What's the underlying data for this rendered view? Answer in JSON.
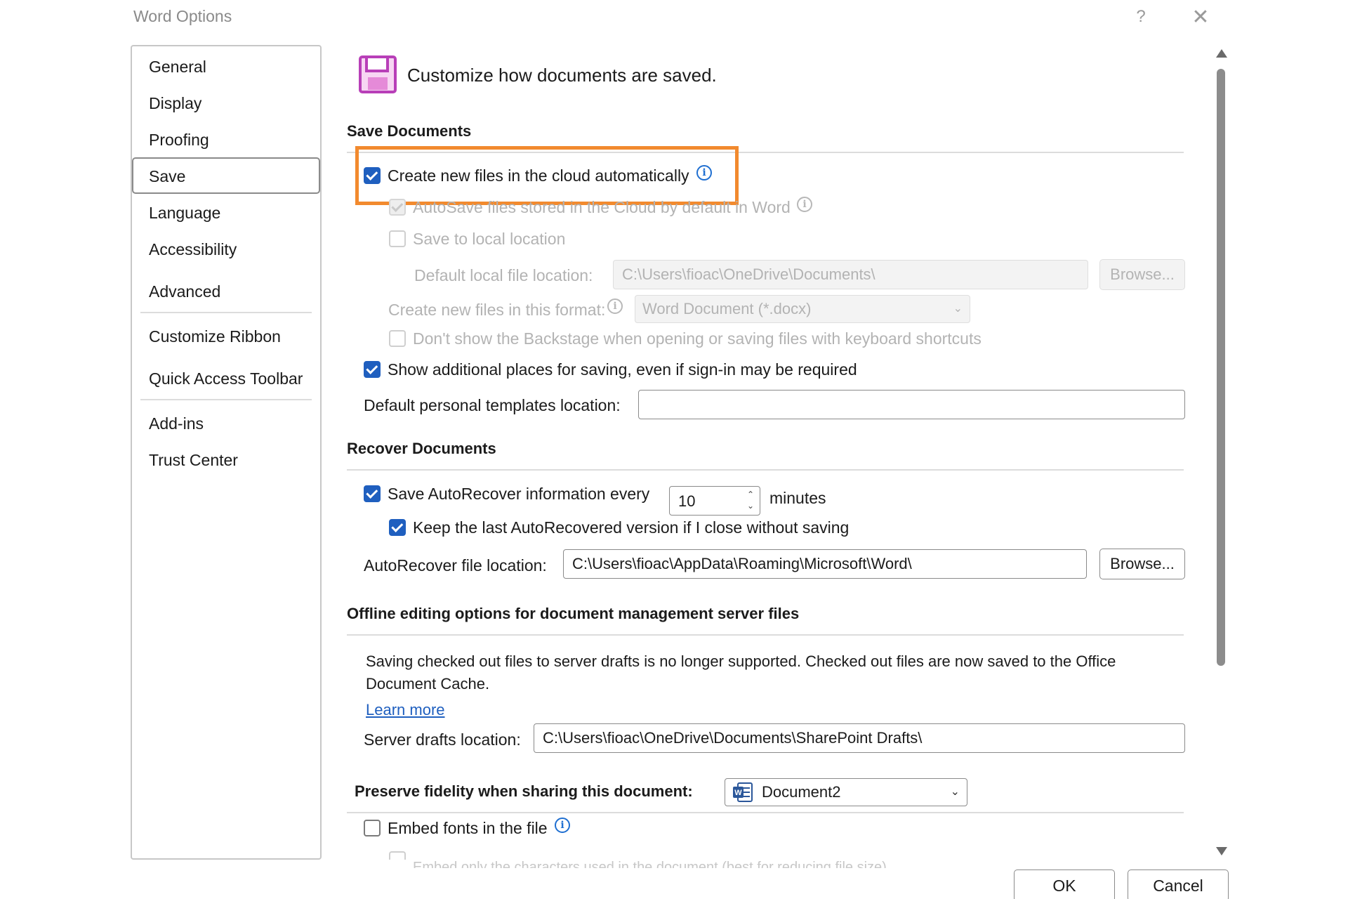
{
  "window": {
    "title": "Word Options",
    "help_label": "?",
    "close_label": "✕"
  },
  "sidebar": {
    "items": [
      {
        "label": "General"
      },
      {
        "label": "Display"
      },
      {
        "label": "Proofing"
      },
      {
        "label": "Save"
      },
      {
        "label": "Language"
      },
      {
        "label": "Accessibility"
      },
      {
        "label": "Advanced"
      },
      {
        "label": "Customize Ribbon"
      },
      {
        "label": "Quick Access Toolbar"
      },
      {
        "label": "Add-ins"
      },
      {
        "label": "Trust Center"
      }
    ],
    "selected": "Save"
  },
  "header": {
    "intro": "Customize how documents are saved."
  },
  "save_documents": {
    "heading": "Save Documents",
    "create_cloud": {
      "label": "Create new files in the cloud automatically",
      "checked": true
    },
    "autosave": {
      "label": "AutoSave files stored in the Cloud by default in Word",
      "checked": true,
      "enabled": false
    },
    "save_local": {
      "label": "Save to local location",
      "checked": false,
      "enabled": false
    },
    "default_local_label": "Default local file location:",
    "default_local_value": "C:\\Users\\fioac\\OneDrive\\Documents\\",
    "browse_label": "Browse...",
    "format_label": "Create new files in this format:",
    "format_value": "Word Document (*.docx)",
    "backstage": {
      "label": "Don't show the Backstage when opening or saving files with keyboard shortcuts",
      "checked": false,
      "enabled": false
    },
    "additional_places": {
      "label": "Show additional places for saving, even if sign-in may be required",
      "checked": true
    },
    "templates_label": "Default personal templates location:",
    "templates_value": ""
  },
  "recover_documents": {
    "heading": "Recover Documents",
    "autorecover": {
      "label": "Save AutoRecover information every",
      "checked": true
    },
    "minutes_value": "10",
    "minutes_label": "minutes",
    "keep_last": {
      "label": "Keep the last AutoRecovered version if I close without saving",
      "checked": true
    },
    "location_label": "AutoRecover file location:",
    "location_value": "C:\\Users\\fioac\\AppData\\Roaming\\Microsoft\\Word\\",
    "browse_label": "Browse..."
  },
  "offline": {
    "heading": "Offline editing options for document management server files",
    "paragraph": "Saving checked out files to server drafts is no longer supported. Checked out files are now saved to the Office Document Cache.",
    "learn_more": "Learn more",
    "drafts_label": "Server drafts location:",
    "drafts_value": "C:\\Users\\fioac\\OneDrive\\Documents\\SharePoint Drafts\\"
  },
  "fidelity": {
    "heading": "Preserve fidelity when sharing this document:",
    "document_value": "Document2",
    "embed_fonts": {
      "label": "Embed fonts in the file",
      "checked": false
    },
    "embed_only": {
      "label": "Embed only the characters used in the document (best for reducing file size)",
      "checked": false,
      "enabled": false
    }
  },
  "footer": {
    "ok_label": "OK",
    "cancel_label": "Cancel"
  },
  "colors": {
    "accent": "#1f5fbf",
    "highlight": "#f28a2e",
    "floppy": "#b83fb8"
  }
}
